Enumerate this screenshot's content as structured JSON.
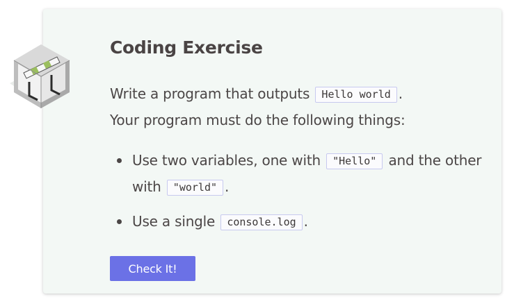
{
  "exercise": {
    "title": "Coding Exercise",
    "icon": "hurdle-cube-icon",
    "intro": {
      "line1_prefix": "Write a program that outputs ",
      "line1_code": "Hello world",
      "line1_suffix": ".",
      "line2": "Your program must do the following things:"
    },
    "tasks": [
      {
        "prefix": "Use two variables, one with ",
        "code1": "\"Hello\"",
        "middle": " and the other with ",
        "code2": "\"world\"",
        "suffix": "."
      },
      {
        "prefix": "Use a single ",
        "code1": "console.log",
        "suffix": "."
      }
    ],
    "check_button_label": "Check It!"
  },
  "colors": {
    "card_background": "#f3f8f5",
    "button": "#6b71e6",
    "code_border": "#c7c9ef",
    "text": "#4b4646"
  }
}
